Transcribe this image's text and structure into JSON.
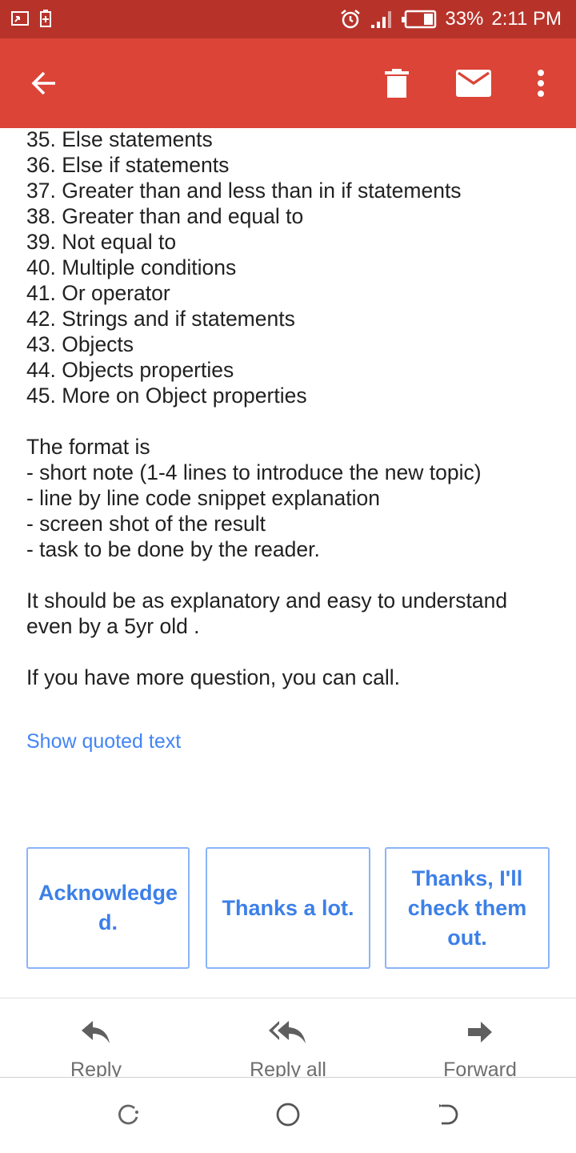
{
  "status_bar": {
    "battery": "33%",
    "time": "2:11 PM"
  },
  "app_bar": {
    "icons": [
      "back-arrow-icon",
      "trash-icon",
      "mail-icon",
      "more-vert-icon"
    ]
  },
  "email": {
    "list": [
      "35. Else statements",
      "36. Else if statements",
      "37. Greater than and less than in if statements",
      "38. Greater than and equal to",
      "39. Not equal to",
      "40. Multiple conditions",
      "41. Or operator",
      "42. Strings and if statements",
      "43. Objects",
      "44. Objects properties",
      "45. More on Object properties"
    ],
    "format": [
      "The format is",
      "- short note (1-4 lines to introduce the new topic)",
      "- line by line code snippet explanation",
      "- screen shot of the result",
      "- task to be done by the reader."
    ],
    "explanatory": [
      "It should be as explanatory and easy to understand",
      "even by a 5yr old ."
    ],
    "closing": "If you have more question, you can call.",
    "show_quoted": "Show quoted text"
  },
  "smart_replies": [
    "Acknowledge d.",
    "Thanks a lot.",
    "Thanks, I'll check them out."
  ],
  "actions": {
    "reply": "Reply",
    "reply_all": "Reply all",
    "forward": "Forward"
  },
  "colors": {
    "status_bar": "#b7332a",
    "app_bar": "#db4437",
    "link": "#4285f4",
    "smart_reply_border": "#8ab4f8"
  }
}
